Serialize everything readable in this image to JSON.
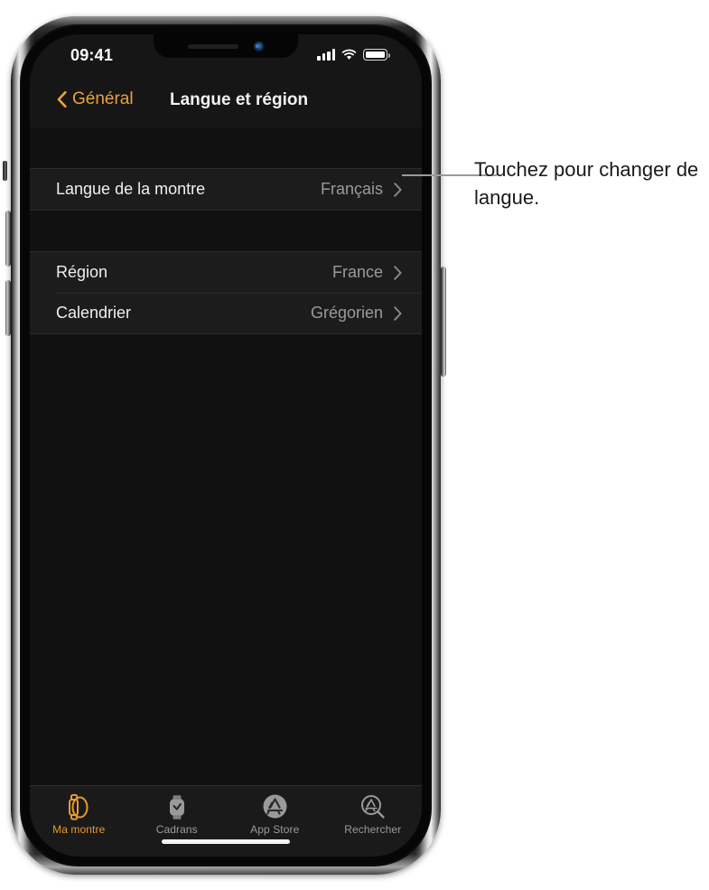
{
  "status_bar": {
    "time": "09:41",
    "cellular_icon": "signal-bars-icon",
    "wifi_icon": "wifi-icon",
    "battery_icon": "battery-full-icon"
  },
  "nav_bar": {
    "back_label": "Général",
    "back_icon": "chevron-left-icon",
    "title": "Langue et région"
  },
  "settings_groups": [
    {
      "rows": [
        {
          "label": "Langue de la montre",
          "value": "Français",
          "accessory_icon": "chevron-right-icon"
        }
      ]
    },
    {
      "rows": [
        {
          "label": "Région",
          "value": "France",
          "accessory_icon": "chevron-right-icon"
        },
        {
          "label": "Calendrier",
          "value": "Grégorien",
          "accessory_icon": "chevron-right-icon"
        }
      ]
    }
  ],
  "tab_bar": {
    "tabs": [
      {
        "label": "Ma montre",
        "icon": "watch-side-icon",
        "active": true
      },
      {
        "label": "Cadrans",
        "icon": "watch-face-icon",
        "active": false
      },
      {
        "label": "App Store",
        "icon": "app-store-icon",
        "active": false
      },
      {
        "label": "Rechercher",
        "icon": "app-store-search-icon",
        "active": false
      }
    ]
  },
  "callout": {
    "text": "Touchez pour changer de langue."
  },
  "colors": {
    "accent_orange": "#e8a33d",
    "tab_active_orange": "#e8992e",
    "screen_background": "#111111",
    "row_background": "#1c1c1c",
    "primary_text": "#efefef",
    "secondary_text": "#9a9a9a"
  }
}
